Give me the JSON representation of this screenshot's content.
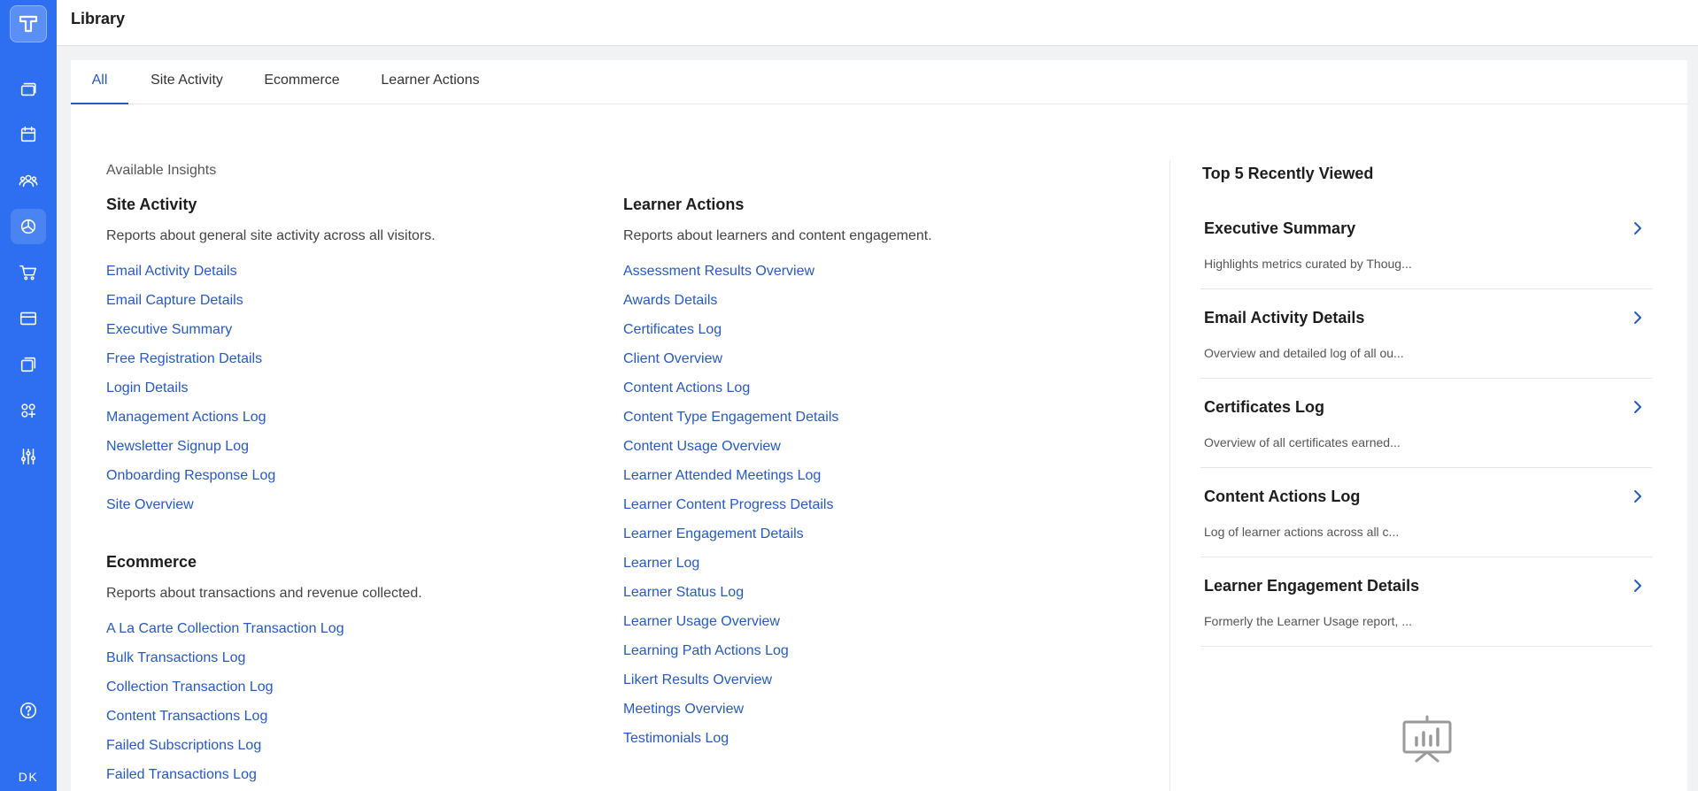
{
  "sidebar": {
    "logo_icon": "teachable-logo-icon",
    "nav_icons": [
      "courses-icon",
      "calendar-icon",
      "users-icon",
      "analytics-icon",
      "cart-icon",
      "card-icon",
      "pages-icon",
      "apps-icon",
      "settings-sliders-icon"
    ],
    "active_icon": "analytics-icon",
    "help_icon": "help-icon",
    "avatar_initials": "DK"
  },
  "header": {
    "title": "Library"
  },
  "tabs": [
    {
      "label": "All",
      "active": true
    },
    {
      "label": "Site Activity",
      "active": false
    },
    {
      "label": "Ecommerce",
      "active": false
    },
    {
      "label": "Learner Actions",
      "active": false
    }
  ],
  "main": {
    "available_label": "Available Insights",
    "site_activity": {
      "title": "Site Activity",
      "description": "Reports about general site activity across all visitors.",
      "links": [
        "Email Activity Details",
        "Email Capture Details",
        "Executive Summary",
        "Free Registration Details",
        "Login Details",
        "Management Actions Log",
        "Newsletter Signup Log",
        "Onboarding Response Log",
        "Site Overview"
      ]
    },
    "ecommerce": {
      "title": "Ecommerce",
      "description": "Reports about transactions and revenue collected.",
      "links": [
        "A La Carte Collection Transaction Log",
        "Bulk Transactions Log",
        "Collection Transaction Log",
        "Content Transactions Log",
        "Failed Subscriptions Log",
        "Failed Transactions Log"
      ]
    },
    "learner_actions": {
      "title": "Learner Actions",
      "description": "Reports about learners and content engagement.",
      "links": [
        "Assessment Results Overview",
        "Awards Details",
        "Certificates Log",
        "Client Overview",
        "Content Actions Log",
        "Content Type Engagement Details",
        "Content Usage Overview",
        "Learner Attended Meetings Log",
        "Learner Content Progress Details",
        "Learner Engagement Details",
        "Learner Log",
        "Learner Status Log",
        "Learner Usage Overview",
        "Learning Path Actions Log",
        "Likert Results Overview",
        "Meetings Overview",
        "Testimonials Log"
      ]
    }
  },
  "recent": {
    "title": "Top 5 Recently Viewed",
    "items": [
      {
        "name": "Executive Summary",
        "desc": "Highlights metrics curated by Thoug..."
      },
      {
        "name": "Email Activity Details",
        "desc": "Overview and detailed log of all ou..."
      },
      {
        "name": "Certificates Log",
        "desc": "Overview of all certificates earned..."
      },
      {
        "name": "Content Actions Log",
        "desc": "Log of learner actions across all c..."
      },
      {
        "name": "Learner Engagement Details",
        "desc": "Formerly the Learner Usage report, ..."
      }
    ]
  },
  "colors": {
    "sidebar": "#2e6ef0",
    "link": "#2559c4",
    "active_tab": "#2559c4"
  }
}
